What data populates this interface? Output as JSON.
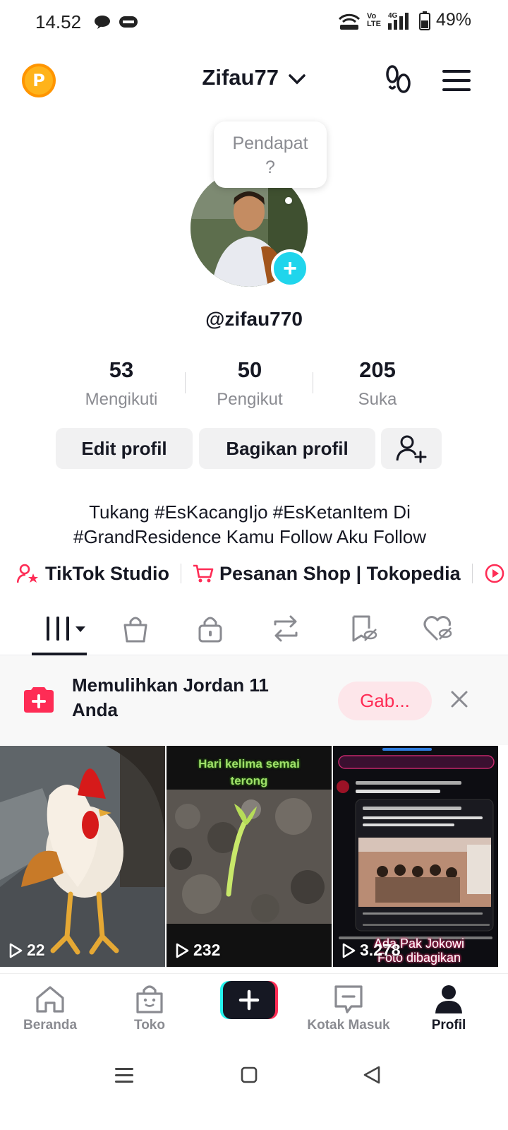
{
  "status_bar": {
    "time": "14.52",
    "battery": "49%",
    "network": "4G",
    "volte": "Vo LTE"
  },
  "header": {
    "coin_label": "P",
    "username": "Zifau77"
  },
  "tooltip": {
    "line1": "Pendapat",
    "line2": "?"
  },
  "profile": {
    "handle": "@zifau770"
  },
  "stats": [
    {
      "value": "53",
      "label": "Mengikuti"
    },
    {
      "value": "50",
      "label": "Pengikut"
    },
    {
      "value": "205",
      "label": "Suka"
    }
  ],
  "actions": {
    "edit": "Edit profil",
    "share": "Bagikan profil"
  },
  "bio": {
    "line1": "Tukang #EsKacangIjo #EsKetanItem Di",
    "line2": "#GrandResidence Kamu Follow Aku Follow"
  },
  "links": {
    "studio": "TikTok Studio",
    "shop": "Pesanan Shop | Tokopedia"
  },
  "banner": {
    "text": "Memulihkan Jordan 11 Anda",
    "button": "Gab..."
  },
  "videos": [
    {
      "views": "22"
    },
    {
      "views": "232",
      "caption": "Hari kelima semai terong"
    },
    {
      "views": "3.278",
      "caption": "Ada Pak Jokowi Foto dibagikan"
    }
  ],
  "nav": {
    "home": "Beranda",
    "shop": "Toko",
    "inbox": "Kotak Masuk",
    "profile": "Profil"
  },
  "colors": {
    "accent": "#fe2c55",
    "cyan": "#20d5ec",
    "text": "#161823",
    "muted": "#8a8b91"
  }
}
